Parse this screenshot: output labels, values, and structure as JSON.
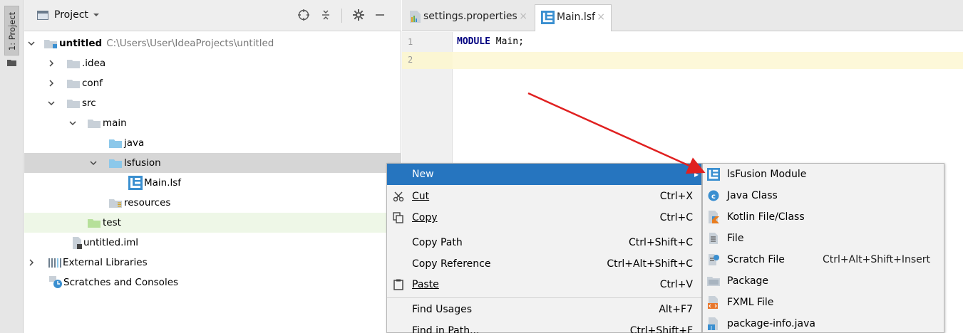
{
  "sidebar_strip": {
    "tab_label": "1: Project"
  },
  "project_panel": {
    "title": "Project",
    "tree": [
      {
        "label": "untitled",
        "path": "C:\\Users\\User\\IdeaProjects\\untitled",
        "bold": true
      },
      {
        "label": ".idea"
      },
      {
        "label": "conf"
      },
      {
        "label": "src"
      },
      {
        "label": "main"
      },
      {
        "label": "java"
      },
      {
        "label": "lsfusion"
      },
      {
        "label": "Main.lsf"
      },
      {
        "label": "resources"
      },
      {
        "label": "test"
      },
      {
        "label": "untitled.iml"
      },
      {
        "label": "External Libraries"
      },
      {
        "label": "Scratches and Consoles"
      }
    ]
  },
  "editor": {
    "tabs": [
      {
        "label": "settings.properties",
        "close": "×"
      },
      {
        "label": "Main.lsf",
        "close": "×"
      }
    ],
    "line_numbers": [
      "1",
      "2"
    ],
    "code": {
      "keyword": "MODULE",
      "rest": " Main;"
    }
  },
  "context_menu": {
    "items": [
      {
        "label": "New",
        "shortcut": ""
      },
      {
        "label": "Cut",
        "shortcut": "Ctrl+X"
      },
      {
        "label": "Copy",
        "shortcut": "Ctrl+C"
      },
      {
        "label": "Copy Path",
        "shortcut": "Ctrl+Shift+C"
      },
      {
        "label": "Copy Reference",
        "shortcut": "Ctrl+Alt+Shift+C"
      },
      {
        "label": "Paste",
        "shortcut": "Ctrl+V"
      },
      {
        "label": "Find Usages",
        "shortcut": "Alt+F7"
      },
      {
        "label": "Find in Path...",
        "shortcut": "Ctrl+Shift+F"
      }
    ]
  },
  "sub_menu": {
    "items": [
      {
        "label": "lsFusion Module",
        "shortcut": ""
      },
      {
        "label": "Java Class",
        "shortcut": ""
      },
      {
        "label": "Kotlin File/Class",
        "shortcut": ""
      },
      {
        "label": "File",
        "shortcut": ""
      },
      {
        "label": "Scratch File",
        "shortcut": "Ctrl+Alt+Shift+Insert"
      },
      {
        "label": "Package",
        "shortcut": ""
      },
      {
        "label": "FXML File",
        "shortcut": ""
      },
      {
        "label": "package-info.java",
        "shortcut": ""
      }
    ]
  },
  "colors": {
    "menu_highlight": "#2675bf",
    "folder": "#c8d0d8",
    "source_folder": "#8cc8ea",
    "test_folder": "#b6e09a",
    "lsf_icon": "#3a8fd0",
    "annotation_arrow": "#e02020"
  }
}
